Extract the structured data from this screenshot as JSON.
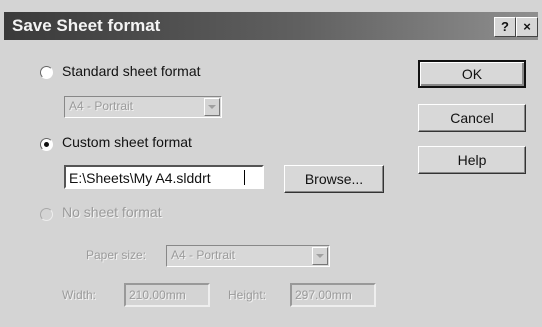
{
  "window": {
    "title": "Save Sheet format",
    "help_glyph": "?",
    "close_glyph": "×"
  },
  "options": {
    "standard": {
      "label": "Standard sheet format",
      "selected": false
    },
    "standard_combo_value": "A4 - Portrait",
    "custom": {
      "label": "Custom sheet format",
      "selected": true
    },
    "custom_path_value": "E:\\Sheets\\My A4.slddrt",
    "none": {
      "label": "No sheet format",
      "selected": false
    },
    "paper_size_label": "Paper size:",
    "paper_size_value": "A4 - Portrait",
    "width_label": "Width:",
    "width_value": "210.00mm",
    "height_label": "Height:",
    "height_value": "297.00mm"
  },
  "buttons": {
    "ok": "OK",
    "cancel": "Cancel",
    "help": "Help",
    "browse": "Browse..."
  }
}
